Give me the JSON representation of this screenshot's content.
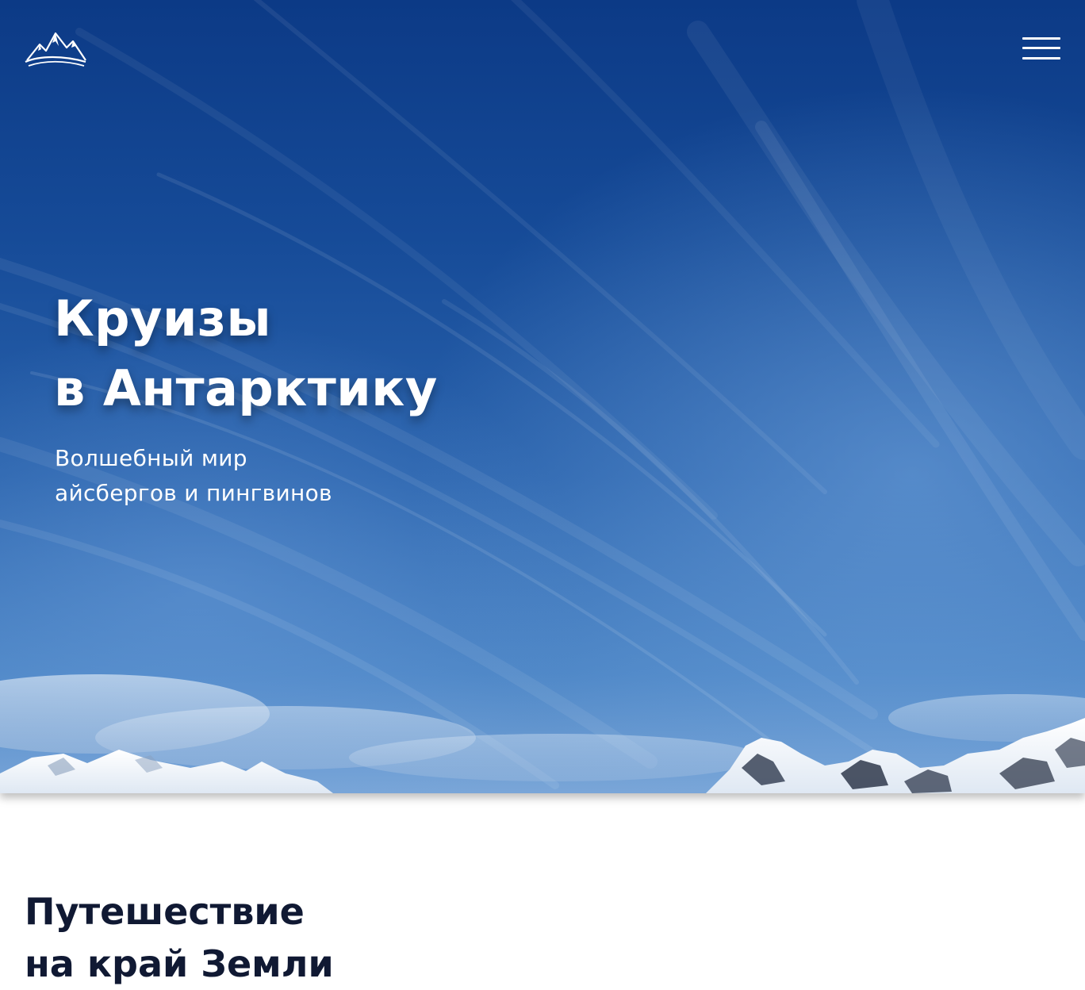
{
  "header": {
    "logo_icon": "mountain-logo-icon",
    "menu_icon": "hamburger-menu-icon"
  },
  "hero": {
    "title_line1": "Круизы",
    "title_line2": "в Антарктику",
    "subtitle_line1": "Волшебный мир",
    "subtitle_line2": "айсбергов и пингвинов",
    "background_icon": "antarctic-sky-mountains-photo"
  },
  "section": {
    "title_line1": "Путешествие",
    "title_line2": "на край Земли"
  },
  "colors": {
    "sky_dark": "#0c3a86",
    "sky_light": "#7aa6d8",
    "heading_dark": "#101933",
    "text_light": "#ffffff"
  }
}
